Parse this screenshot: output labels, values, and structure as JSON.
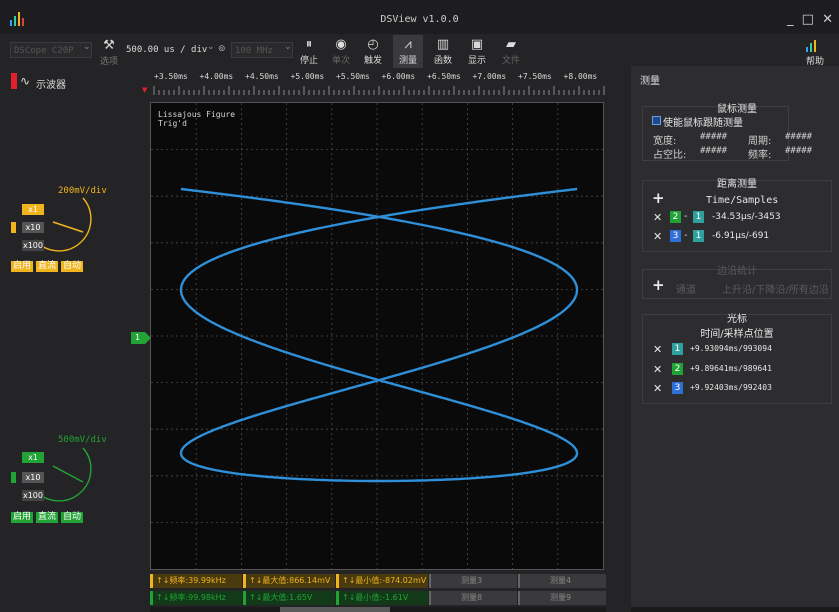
{
  "titlebar": {
    "title": "DSView v1.0.0",
    "controls": "_ □ ✕"
  },
  "toolbar": {
    "device": "DSCope C20P",
    "options_label": "选项",
    "timebase": "500.00 us / div",
    "samplerate": "100 MHz",
    "buttons": {
      "stop": "停止",
      "single": "单次",
      "trigger": "触发",
      "measure": "测量",
      "decode": "函数",
      "display": "显示",
      "file": "文件",
      "help": "帮助"
    }
  },
  "left": {
    "instrument_label": "示波器",
    "ch1": {
      "vdiv": "200mV/div",
      "probes": [
        "x1",
        "x10",
        "x100"
      ],
      "enable": "启用",
      "coupling": "直流",
      "auto": "自动",
      "color": "#f0b41e"
    },
    "ch2": {
      "vdiv": "500mV/div",
      "probes": [
        "x1",
        "x10",
        "x100"
      ],
      "enable": "启用",
      "coupling": "直流",
      "auto": "自动",
      "color": "#21a336"
    },
    "ch1_marker": "1"
  },
  "ruler": {
    "labels": [
      "+3.50ms",
      "+4.00ms",
      "+4.50ms",
      "+5.00ms",
      "+5.50ms",
      "+6.00ms",
      "+6.50ms",
      "+7.00ms",
      "+7.50ms",
      "+8.00ms"
    ]
  },
  "plot": {
    "title": "Lissajous Figure",
    "status": "Trig'd",
    "trace_color": "#2f8fd8"
  },
  "measure_bar": {
    "row1": [
      "↑↓频率:39.99kHz",
      "↑↓最大值:866.14mV",
      "↑↓最小值:-874.02mV",
      "测量3",
      "测量4"
    ],
    "row2": [
      "↑↓频率:99.98kHz",
      "↑↓最大值:1.65V",
      "↑↓最小值:-1.61V",
      "测量8",
      "测量9"
    ]
  },
  "right": {
    "title": "测量",
    "cursor_measure": {
      "title": "鼠标测量",
      "enable_label": "使能鼠标跟随测量",
      "width_label": "宽度:",
      "width_value": "#####",
      "period_label": "周期:",
      "period_value": "#####",
      "duty_label": "占空比:",
      "duty_value": "#####",
      "freq_label": "频率:",
      "freq_value": "#####"
    },
    "distance": {
      "title": "距离测量",
      "header": "Time/Samples",
      "rows": [
        {
          "a": "2",
          "b": "1",
          "value": "-34.53μs/-3453"
        },
        {
          "a": "3",
          "b": "1",
          "value": "-6.91μs/-691"
        }
      ]
    },
    "edges": {
      "title": "边沿统计",
      "header_a": "通道",
      "header_b": "上升沿/下降沿/所有边沿"
    },
    "cursors": {
      "title": "光标",
      "header": "时间/采样点位置",
      "rows": [
        {
          "id": "1",
          "value": "+9.93094ms/993094"
        },
        {
          "id": "2",
          "value": "+9.89641ms/989641"
        },
        {
          "id": "3",
          "value": "+9.92403ms/992403"
        }
      ]
    }
  }
}
